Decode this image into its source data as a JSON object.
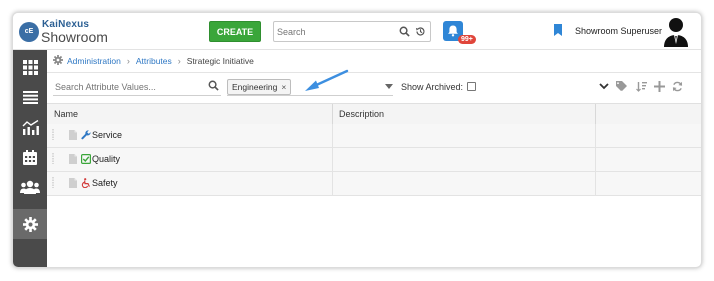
{
  "app": {
    "logo_top": "KaiNexus",
    "logo_bottom": "Showroom",
    "logo_mark": "cE"
  },
  "header": {
    "create_label": "CREATE",
    "search_placeholder": "Search",
    "notification_count": "99+",
    "user_name": "Showroom Superuser"
  },
  "breadcrumb": {
    "items": [
      "Administration",
      "Attributes",
      "Strategic Initiative"
    ]
  },
  "filters": {
    "attr_search_placeholder": "Search Attribute Values...",
    "selected_tag": "Engineering",
    "show_archived_label": "Show Archived:"
  },
  "table": {
    "columns": [
      "Name",
      "Description"
    ],
    "rows": [
      {
        "label": "Service",
        "icon": "wrench-icon",
        "icon_color": "#2f78c4"
      },
      {
        "label": "Quality",
        "icon": "checkbox-icon",
        "icon_color": "#3aa63a"
      },
      {
        "label": "Safety",
        "icon": "wheelchair-icon",
        "icon_color": "#d23b3b"
      }
    ]
  },
  "colors": {
    "create": "#3aa63a",
    "brand_blue": "#2f78c4",
    "sidebar": "#4a4a4a",
    "badge": "#e0463b"
  }
}
